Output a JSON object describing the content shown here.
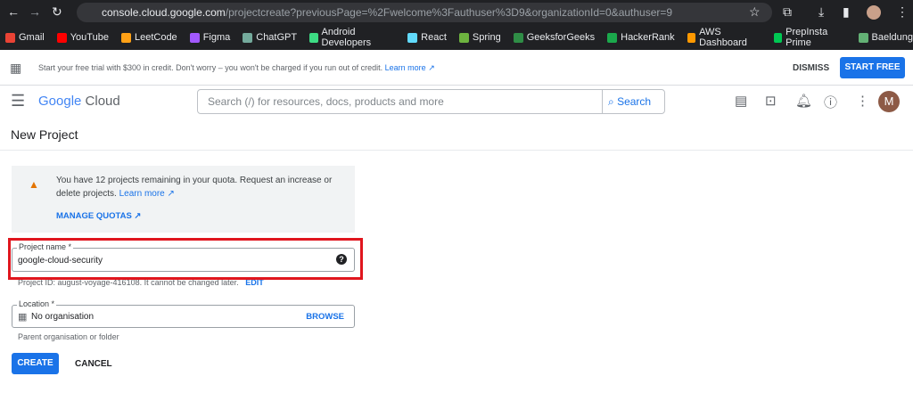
{
  "browser": {
    "url_host": "console.cloud.google.com",
    "url_path": "/projectcreate?previousPage=%2Fwelcome%3Fauthuser%3D9&organizationId=0&authuser=9",
    "bookmarks": [
      {
        "label": "Gmail",
        "color": "#ea4335"
      },
      {
        "label": "YouTube",
        "color": "#ff0000"
      },
      {
        "label": "LeetCode",
        "color": "#ffa116"
      },
      {
        "label": "Figma",
        "color": "#a259ff"
      },
      {
        "label": "ChatGPT",
        "color": "#74aa9c"
      },
      {
        "label": "Android Developers",
        "color": "#3ddc84"
      },
      {
        "label": "React",
        "color": "#61dafb"
      },
      {
        "label": "Spring",
        "color": "#6db33f"
      },
      {
        "label": "GeeksforGeeks",
        "color": "#2f8d46"
      },
      {
        "label": "HackerRank",
        "color": "#1ba94c"
      },
      {
        "label": "AWS Dashboard",
        "color": "#ff9900"
      },
      {
        "label": "PrepInsta Prime",
        "color": "#00c853"
      },
      {
        "label": "Baeldung",
        "color": "#63b175"
      }
    ],
    "avatar": "M"
  },
  "banner": {
    "text": "Start your free trial with $300 in credit. Don't worry – you won't be charged if you run out of credit.",
    "link": "Learn more",
    "dismiss": "DISMISS",
    "start": "START FREE"
  },
  "header": {
    "logo_google": "Google",
    "logo_cloud": "Cloud",
    "search_placeholder": "Search (/) for resources, docs, products and more",
    "search_btn": "Search",
    "avatar": "M"
  },
  "page": {
    "title": "New Project"
  },
  "quota": {
    "text": "You have 12 projects remaining in your quota. Request an increase or delete projects.",
    "learn_more": "Learn more",
    "manage": "MANAGE QUOTAS"
  },
  "form": {
    "project_label": "Project name *",
    "project_value": "google-cloud-security",
    "project_id_hint": "Project ID: august-voyage-416108. It cannot be changed later.",
    "edit": "EDIT",
    "location_label": "Location *",
    "location_value": "No organisation",
    "browse": "BROWSE",
    "location_hint": "Parent organisation or folder",
    "create": "CREATE",
    "cancel": "CANCEL"
  },
  "highlight_color": "#e0161e"
}
